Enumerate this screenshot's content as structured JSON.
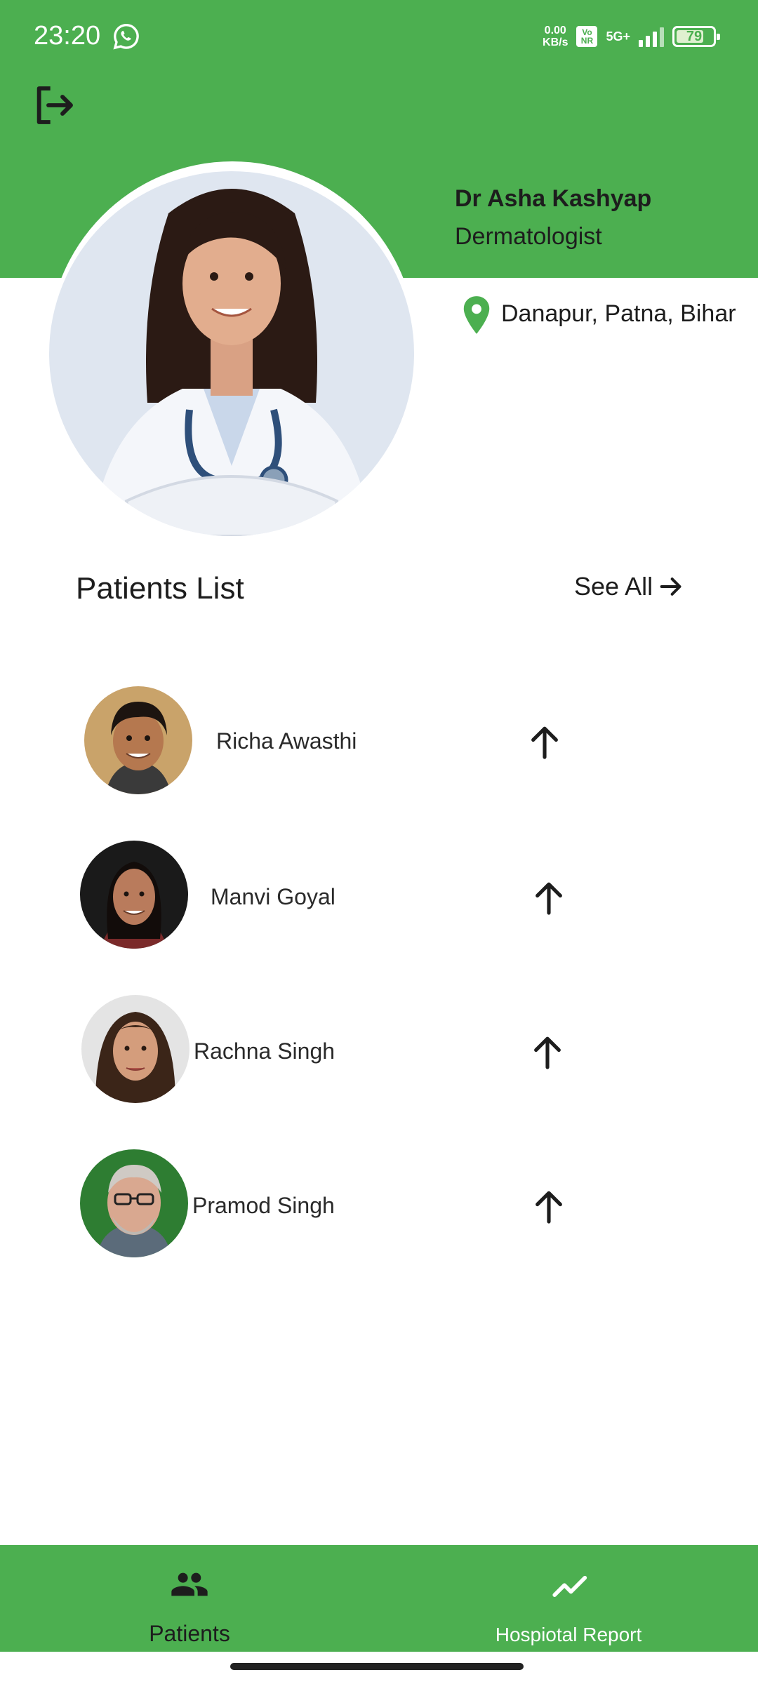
{
  "status_bar": {
    "time": "23:20",
    "net_speed_value": "0.00",
    "net_speed_unit": "KB/s",
    "vonr": "Vo NR",
    "network": "5G+",
    "battery": "79",
    "battery_level": 0.79,
    "icons": [
      "whatsapp-icon",
      "signal-icon",
      "battery-icon"
    ]
  },
  "header": {
    "logout_icon": "logout-icon",
    "accent_color": "#4caf50"
  },
  "doctor": {
    "name": "Dr Asha Kashyap",
    "specialty": "Dermatologist",
    "location": "Danapur, Patna, Bihar",
    "location_icon": "location-pin-icon"
  },
  "patients_section": {
    "title": "Patients List",
    "see_all_label": "See All",
    "see_all_icon": "arrow-right-icon"
  },
  "patients": [
    {
      "name": "Richa Awasthi",
      "action_icon": "arrow-up-icon"
    },
    {
      "name": "Manvi Goyal",
      "action_icon": "arrow-up-icon"
    },
    {
      "name": "Rachna Singh",
      "action_icon": "arrow-up-icon"
    },
    {
      "name": "Pramod Singh",
      "action_icon": "arrow-up-icon"
    }
  ],
  "bottom_nav": {
    "items": [
      {
        "label": "Patients",
        "icon": "people-icon",
        "active": true
      },
      {
        "label": "Hospiotal Report",
        "icon": "trending-up-icon",
        "active": false
      }
    ]
  }
}
